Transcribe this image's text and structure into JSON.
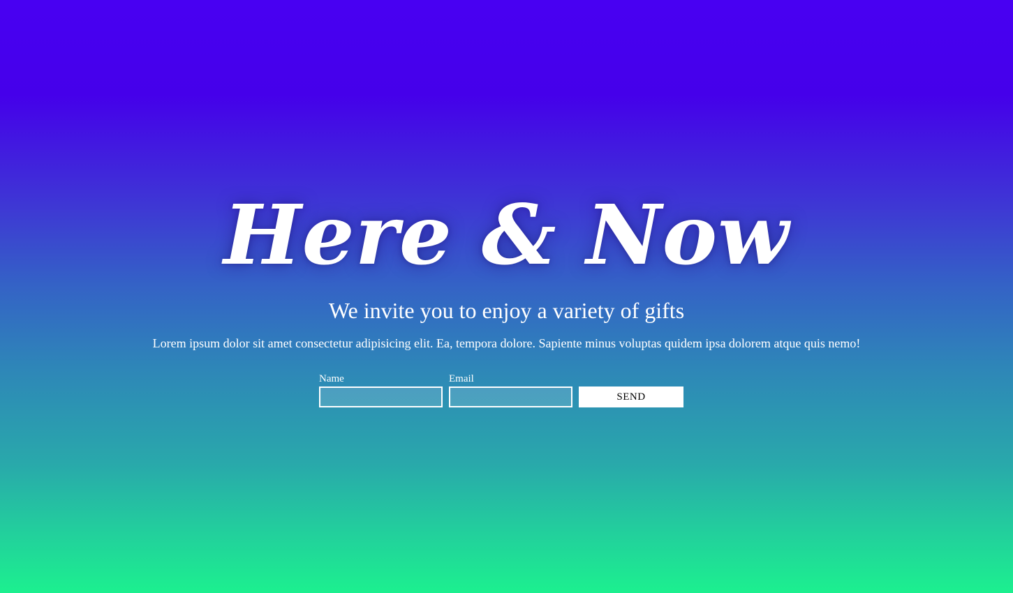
{
  "hero": {
    "title": "Here & Now",
    "subtitle": "We invite you to enjoy a variety of gifts",
    "lead": "Lorem ipsum dolor sit amet consectetur adipisicing elit. Ea, tempora dolore. Sapiente minus voluptas quidem ipsa dolorem atque quis nemo!"
  },
  "form": {
    "name_label": "Name",
    "name_value": "",
    "email_label": "Email",
    "email_value": "",
    "send_label": "SEND"
  },
  "colors": {
    "gradient_top": "#4800f2",
    "gradient_bottom": "#1cf08f",
    "text": "#ffffff",
    "button_bg": "#ffffff",
    "button_text": "#000000"
  }
}
